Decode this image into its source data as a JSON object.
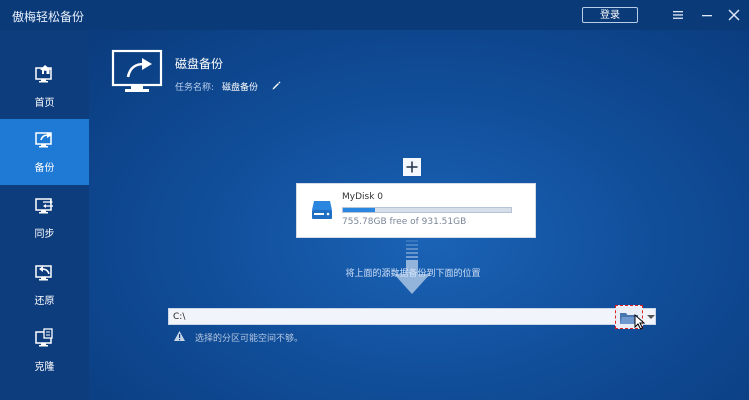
{
  "window": {
    "title": "傲梅轻松备份",
    "login_label": "登录"
  },
  "icons": {
    "menu": "menu-icon",
    "minimize": "minimize-icon",
    "close": "close-icon"
  },
  "sidebar": {
    "items": [
      {
        "label": "首页",
        "icon": "home-icon",
        "active": false
      },
      {
        "label": "备份",
        "icon": "backup-icon",
        "active": true
      },
      {
        "label": "同步",
        "icon": "sync-icon",
        "active": false
      },
      {
        "label": "还原",
        "icon": "restore-icon",
        "active": false
      },
      {
        "label": "克隆",
        "icon": "clone-icon",
        "active": false
      }
    ]
  },
  "task": {
    "title": "磁盘备份",
    "name_label": "任务名称:",
    "name_value": "磁盘备份"
  },
  "source": {
    "disk_name": "MyDisk 0",
    "usage_text": "755.78GB free of 931.51GB",
    "used_fraction": 0.19
  },
  "hint_text": "将上面的源数据备份到下面的位置",
  "destination": {
    "path": "C:\\",
    "warning": "选择的分区可能空间不够。"
  },
  "colors": {
    "accent": "#1f7ad6",
    "sidebar_bg": "#0e3d7e",
    "titlebar_bg": "#0a3a78",
    "progress": "#2a86de",
    "browse_highlight": "#e02020"
  }
}
